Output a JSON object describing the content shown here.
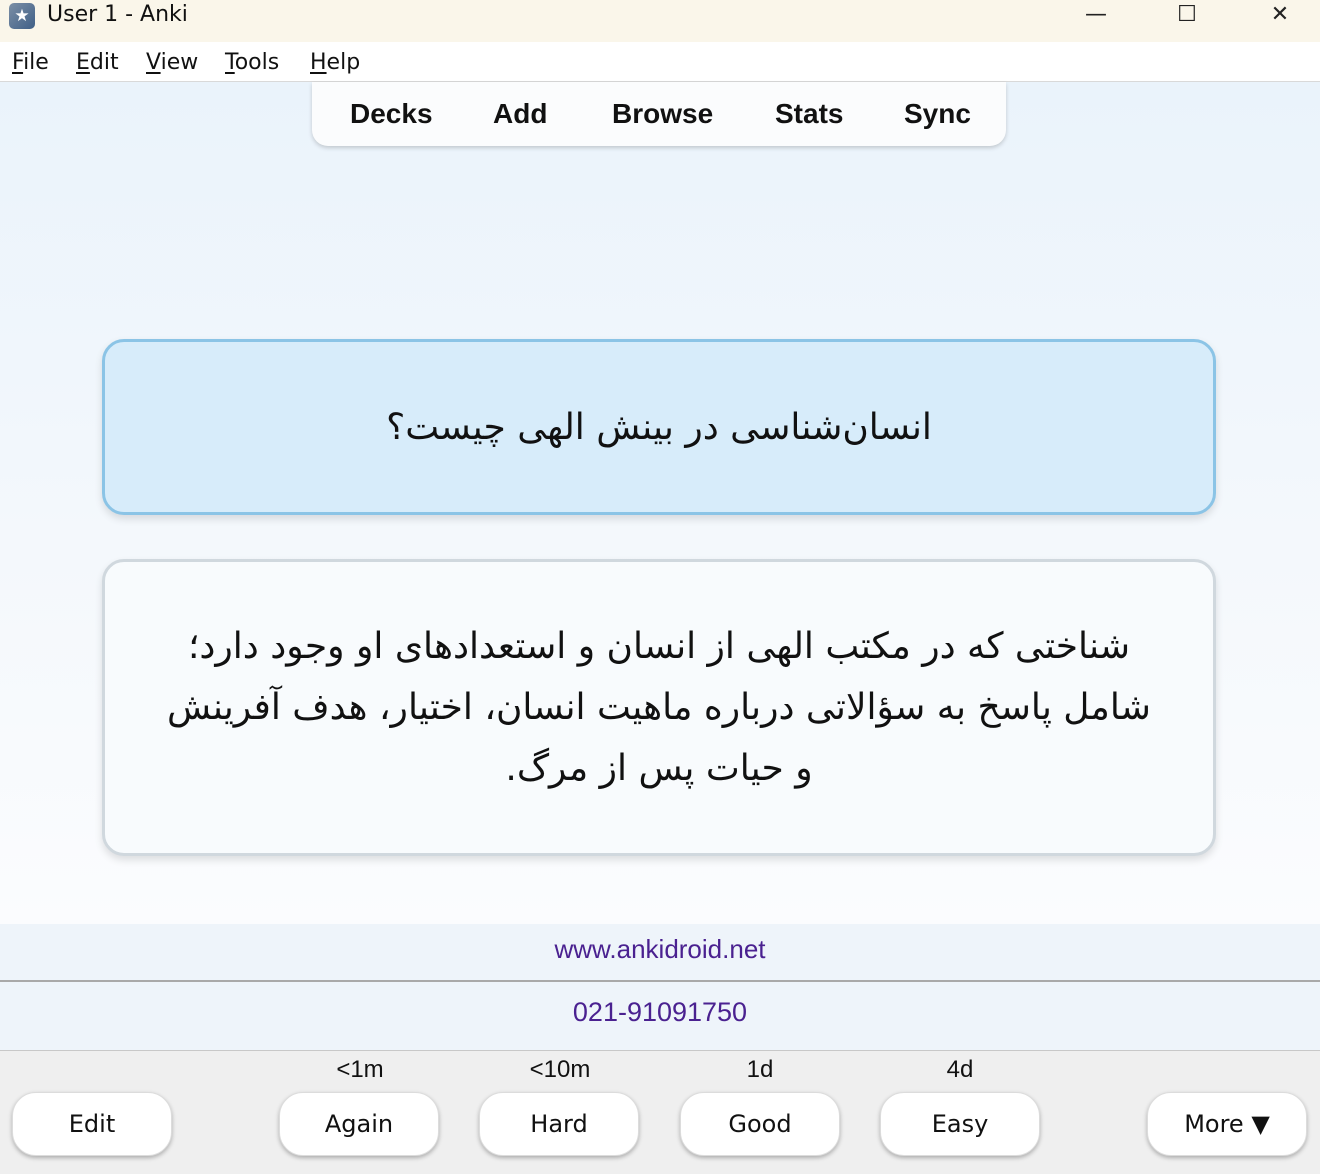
{
  "window": {
    "title": "User 1 - Anki",
    "app_icon": "anki-star-icon",
    "controls": {
      "minimize": "—",
      "maximize": "☐",
      "close": "✕"
    }
  },
  "menu": {
    "file": {
      "mnemonic": "F",
      "rest": "ile"
    },
    "edit": {
      "mnemonic": "E",
      "rest": "dit"
    },
    "view": {
      "mnemonic": "V",
      "rest": "iew"
    },
    "tools": {
      "mnemonic": "T",
      "rest": "ools"
    },
    "help": {
      "mnemonic": "H",
      "rest": "elp"
    }
  },
  "toolbar": {
    "decks": "Decks",
    "add": "Add",
    "browse": "Browse",
    "stats": "Stats",
    "sync": "Sync"
  },
  "card": {
    "question": "انسان‌شناسی در بینش الهی چیست؟",
    "answer": "شناختی که در مکتب الهی از انسان و استعدادهای او وجود دارد؛ شامل پاسخ به سؤالاتی درباره ماهیت انسان، اختیار، هدف آفرینش و حیات پس از مرگ."
  },
  "footer_links": {
    "website": "www.ankidroid.net",
    "phone": "021-91091750"
  },
  "answer_bar": {
    "edit": "Edit",
    "again": {
      "label": "Again",
      "interval": "<1m"
    },
    "hard": {
      "label": "Hard",
      "interval": "<10m"
    },
    "good": {
      "label": "Good",
      "interval": "1d"
    },
    "easy": {
      "label": "Easy",
      "interval": "4d"
    },
    "more": "More ▼"
  }
}
